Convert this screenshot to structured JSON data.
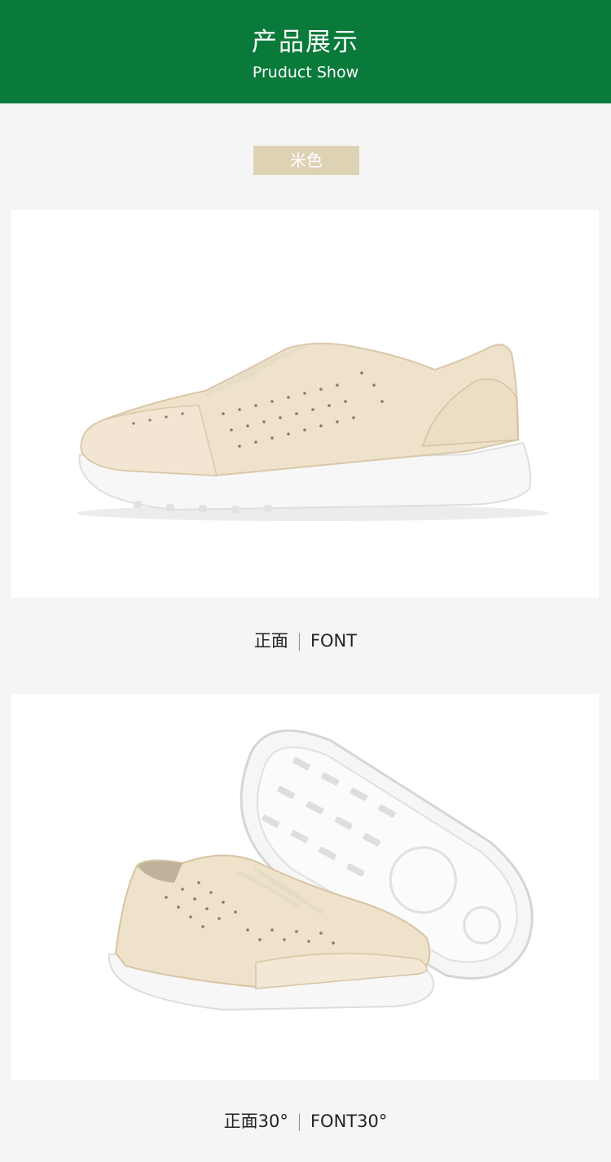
{
  "header": {
    "title": "产品展示",
    "subtitle": "Pruduct Show",
    "background_color": "#097a3a"
  },
  "color_tag": {
    "label": "米色",
    "background_color": "#ddd2b4"
  },
  "photos": [
    {
      "caption_cn": "正面",
      "caption_separator": "|",
      "caption_en": "FONT"
    },
    {
      "caption_cn": "正面30°",
      "caption_separator": "|",
      "caption_en": "FONT30°"
    }
  ]
}
